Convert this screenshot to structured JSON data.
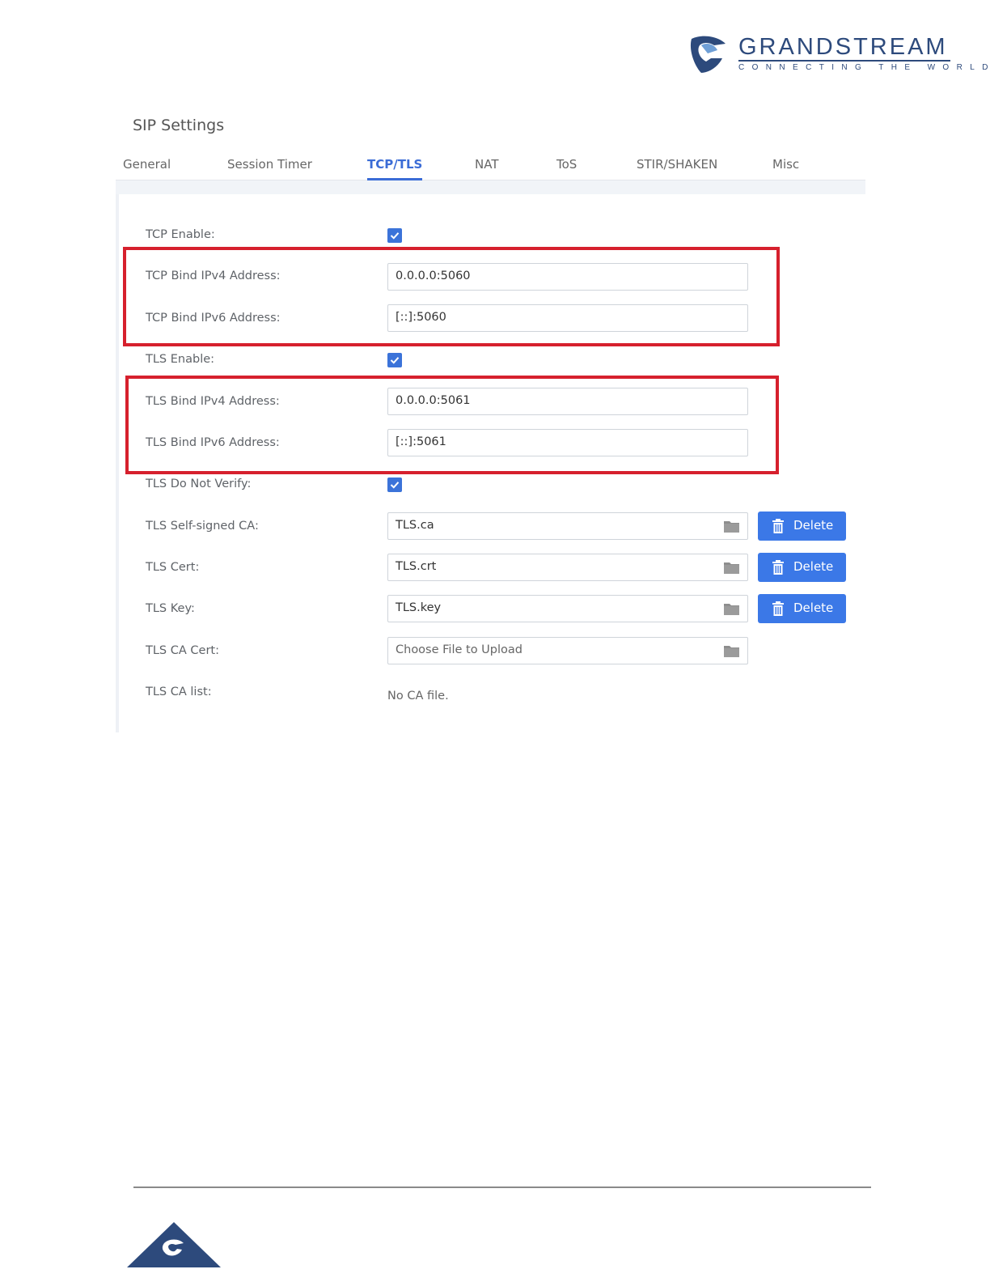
{
  "brand": {
    "name": "GRANDSTREAM",
    "tagline": "CONNECTING THE WORLD",
    "color": "#2d4a7c"
  },
  "page": {
    "title": "SIP Settings"
  },
  "tabs": [
    {
      "label": "General",
      "active": false
    },
    {
      "label": "Session Timer",
      "active": false
    },
    {
      "label": "TCP/TLS",
      "active": true
    },
    {
      "label": "NAT",
      "active": false
    },
    {
      "label": "ToS",
      "active": false
    },
    {
      "label": "STIR/SHAKEN",
      "active": false
    },
    {
      "label": "Misc",
      "active": false
    }
  ],
  "form": {
    "tcp_enable": {
      "label": "TCP Enable:",
      "checked": true
    },
    "tcp_ipv4": {
      "label": "TCP Bind IPv4 Address:",
      "value": "0.0.0.0:5060"
    },
    "tcp_ipv6": {
      "label": "TCP Bind IPv6 Address:",
      "value": "[::]:5060"
    },
    "tls_enable": {
      "label": "TLS Enable:",
      "checked": true
    },
    "tls_ipv4": {
      "label": "TLS Bind IPv4 Address:",
      "value": "0.0.0.0:5061"
    },
    "tls_ipv6": {
      "label": "TLS Bind IPv6 Address:",
      "value": "[::]:5061"
    },
    "tls_no_verify": {
      "label": "TLS Do Not Verify:",
      "checked": true
    },
    "tls_ca": {
      "label": "TLS Self-signed CA:",
      "value": "TLS.ca",
      "button": "Delete"
    },
    "tls_cert": {
      "label": "TLS Cert:",
      "value": "TLS.crt",
      "button": "Delete"
    },
    "tls_key": {
      "label": "TLS Key:",
      "value": "TLS.key",
      "button": "Delete"
    },
    "tls_ca_cert": {
      "label": "TLS CA Cert:",
      "placeholder": "Choose File to Upload"
    },
    "tls_ca_list": {
      "label": "TLS CA list:",
      "value": "No CA file."
    }
  },
  "colors": {
    "accent": "#3b6cd6",
    "button": "#3b78e7",
    "highlight": "#d6202d"
  }
}
